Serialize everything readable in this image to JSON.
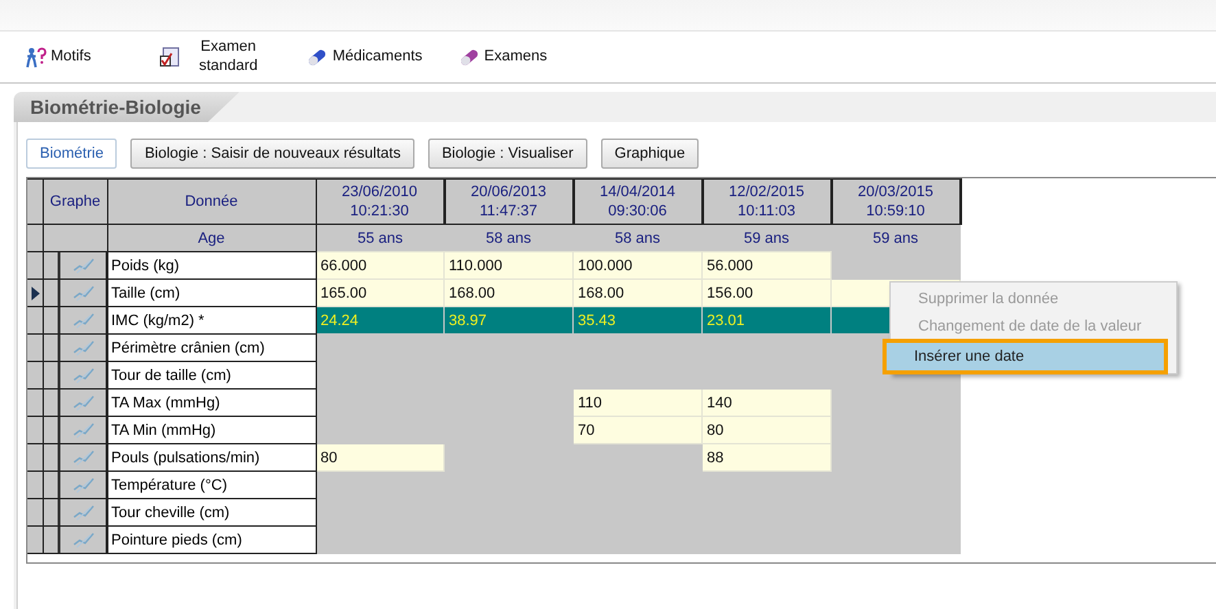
{
  "toolbar": [
    {
      "label": "Motifs"
    },
    {
      "label": "Examen standard"
    },
    {
      "label": "Médicaments"
    },
    {
      "label": "Examens"
    }
  ],
  "panel": {
    "title": "Biométrie-Biologie"
  },
  "tabs": [
    {
      "label": "Biométrie",
      "selected": true
    },
    {
      "label": "Biologie : Saisir de nouveaux résultats",
      "selected": false
    },
    {
      "label": "Biologie : Visualiser",
      "selected": false
    },
    {
      "label": "Graphique",
      "selected": false
    }
  ],
  "table": {
    "columns": [
      "Graphe",
      "Donnée"
    ],
    "dates": [
      {
        "date": "23/06/2010",
        "time": "10:21:30"
      },
      {
        "date": "20/06/2013",
        "time": "11:47:37"
      },
      {
        "date": "14/04/2014",
        "time": "09:30:06"
      },
      {
        "date": "12/02/2015",
        "time": "10:11:03"
      },
      {
        "date": "20/03/2015",
        "time": "10:59:10"
      }
    ],
    "age_label": "Age",
    "ages": [
      "55 ans",
      "58 ans",
      "58 ans",
      "59 ans",
      "59 ans"
    ],
    "rows": [
      {
        "name": "Poids (kg)",
        "kind": "measure",
        "current": false,
        "cells": [
          {
            "text": "66.000",
            "filled": true
          },
          {
            "text": "110.000",
            "filled": true
          },
          {
            "text": "100.000",
            "filled": true
          },
          {
            "text": "56.000",
            "filled": true
          },
          {
            "filled": false
          }
        ]
      },
      {
        "name": "Taille (cm)",
        "kind": "measure",
        "current": true,
        "cells": [
          {
            "text": "165.00",
            "filled": true
          },
          {
            "text": "168.00",
            "filled": true
          },
          {
            "text": "168.00",
            "filled": true
          },
          {
            "text": "156.00",
            "filled": true
          },
          {
            "filled": true
          }
        ]
      },
      {
        "name": "IMC (kg/m2) *",
        "kind": "computed",
        "current": false,
        "cells": [
          {
            "text": "24.24",
            "filled": true
          },
          {
            "text": "38.97",
            "filled": true
          },
          {
            "text": "35.43",
            "filled": true
          },
          {
            "text": "23.01",
            "filled": true
          },
          {
            "filled": true
          }
        ]
      },
      {
        "name": "Périmètre crânien (cm)",
        "kind": "measure",
        "current": false,
        "cells": [
          {
            "filled": false
          },
          {
            "filled": false
          },
          {
            "filled": false
          },
          {
            "filled": false
          },
          {
            "filled": false
          }
        ]
      },
      {
        "name": "Tour de taille (cm)",
        "kind": "measure",
        "current": false,
        "cells": [
          {
            "filled": false
          },
          {
            "filled": false
          },
          {
            "filled": false
          },
          {
            "filled": false
          },
          {
            "filled": false
          }
        ]
      },
      {
        "name": "TA Max (mmHg)",
        "kind": "measure",
        "current": false,
        "cells": [
          {
            "filled": false
          },
          {
            "filled": false
          },
          {
            "text": "110",
            "filled": true
          },
          {
            "text": "140",
            "filled": true
          },
          {
            "filled": false
          }
        ]
      },
      {
        "name": "TA Min (mmHg)",
        "kind": "measure",
        "current": false,
        "cells": [
          {
            "filled": false
          },
          {
            "filled": false
          },
          {
            "text": "70",
            "filled": true
          },
          {
            "text": "80",
            "filled": true
          },
          {
            "filled": false
          }
        ]
      },
      {
        "name": "Pouls (pulsations/min)",
        "kind": "measure",
        "current": false,
        "cells": [
          {
            "text": "80",
            "filled": true
          },
          {
            "filled": false
          },
          {
            "filled": false
          },
          {
            "text": "88",
            "filled": true
          },
          {
            "filled": false
          }
        ]
      },
      {
        "name": "Température (°C)",
        "kind": "measure",
        "current": false,
        "cells": [
          {
            "filled": false
          },
          {
            "filled": false
          },
          {
            "filled": false
          },
          {
            "filled": false
          },
          {
            "filled": false
          }
        ]
      },
      {
        "name": "Tour cheville (cm)",
        "kind": "measure",
        "current": false,
        "cells": [
          {
            "filled": false
          },
          {
            "filled": false
          },
          {
            "filled": false
          },
          {
            "filled": false
          },
          {
            "filled": false
          }
        ]
      },
      {
        "name": "Pointure pieds (cm)",
        "kind": "measure",
        "current": false,
        "cells": [
          {
            "filled": false
          },
          {
            "filled": false
          },
          {
            "filled": false
          },
          {
            "filled": false
          },
          {
            "filled": false
          }
        ]
      }
    ]
  },
  "context_menu": [
    {
      "label": "Supprimer la donnée",
      "disabled": true,
      "selected": false
    },
    {
      "label": "Changement de date de la valeur",
      "disabled": true,
      "selected": false
    },
    {
      "label": "Insérer une date",
      "disabled": false,
      "selected": true
    }
  ]
}
